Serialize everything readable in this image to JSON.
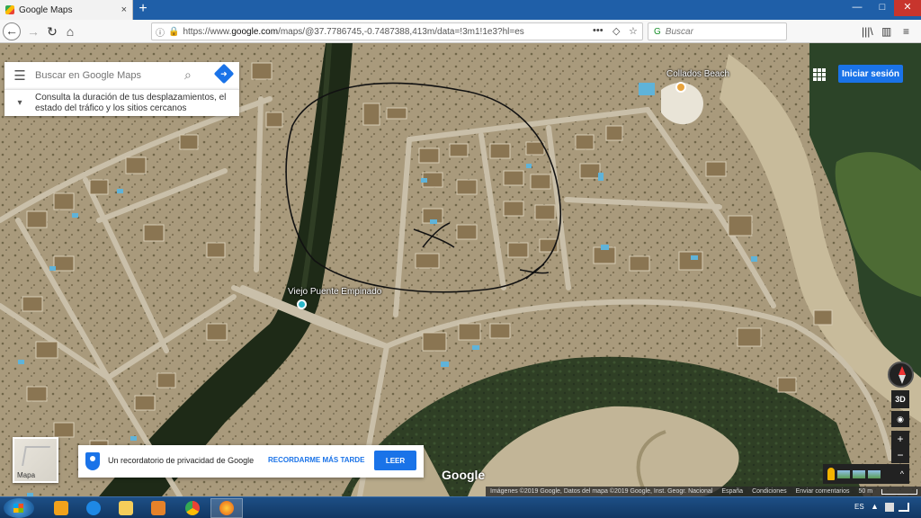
{
  "browser": {
    "tab_title": "Google Maps",
    "tab_close": "×",
    "new_tab": "+",
    "url_prefix": "https://www.",
    "url_domain": "google.com",
    "url_path": "/maps/@37.7786745,-0.7487388,413m/data=!3m1!1e3?hl=es",
    "search_placeholder": "Buscar",
    "buttons": {
      "back": "←",
      "forward": "→",
      "reload": "↻",
      "home": "⌂",
      "more": "•••",
      "pocket": "◇",
      "bookmark": "☆",
      "library": "|||\\",
      "sidebar": "▥",
      "menu": "≡"
    },
    "window": {
      "minimize": "—",
      "maximize": "□",
      "close": "✕"
    }
  },
  "maps": {
    "search_placeholder": "Buscar en Google Maps",
    "menu_icon": "hamburger-icon",
    "tip_text": "Consulta la duración de tus desplazamientos, el estado del tráfico y los sitios cercanos",
    "signin_label": "Iniciar sesión",
    "places": {
      "colladas": "Collados Beach",
      "puente": "Viejo Puente Empinado"
    },
    "layers_label": "Mapa",
    "privacy": {
      "text": "Un recordatorio de privacidad de Google",
      "later_label": "RECORDARME MÁS TARDE",
      "read_label": "LEER"
    },
    "logo": "Google",
    "controls": {
      "three_d": "3D",
      "zoom_in": "+",
      "zoom_out": "−",
      "locate": "◉",
      "expand": "^"
    },
    "footer": {
      "credits": "Imágenes ©2019 Google, Datos del mapa ©2019 Google, Inst. Geogr. Nacional",
      "country": "España",
      "terms": "Condiciones",
      "feedback": "Enviar comentarios",
      "scale": "50 m"
    }
  },
  "taskbar": {
    "apps": [
      "outlook-icon",
      "internet-explorer-icon",
      "file-explorer-icon",
      "media-player-icon",
      "chrome-icon",
      "firefox-icon"
    ],
    "language": "ES",
    "tray_arrow": "▲"
  },
  "colors": {
    "accent": "#1a73e8",
    "taskbar": "#1d4f86",
    "tab_bar": "#1f5fa8"
  }
}
